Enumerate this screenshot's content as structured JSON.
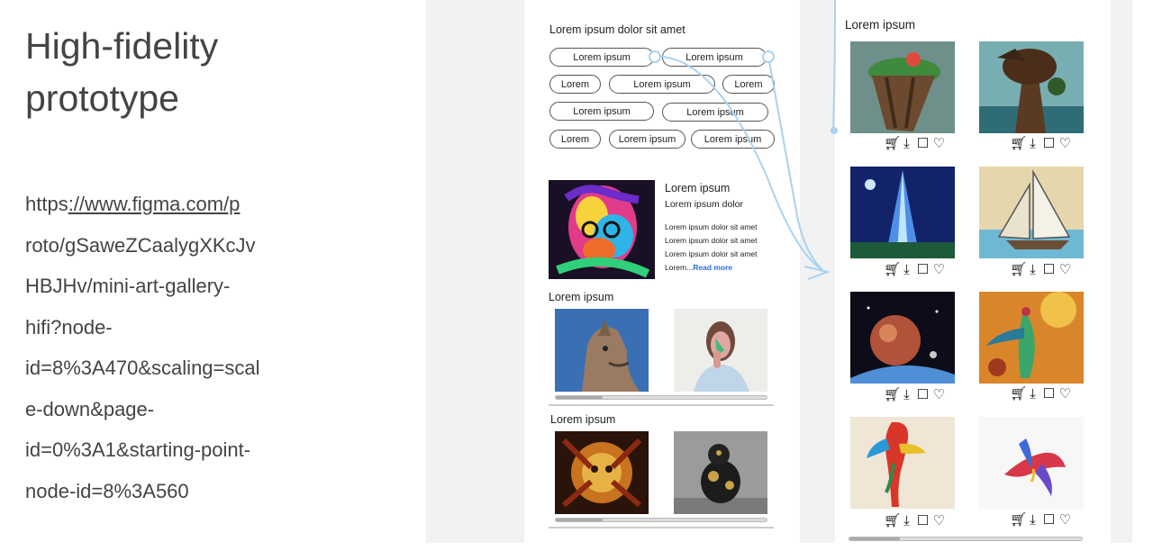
{
  "slide": {
    "title_line1": "High-fidelity",
    "title_line2": "prototype",
    "url_lines": [
      {
        "a": "https",
        "u": "://www.figma.com/p",
        "b": ""
      },
      {
        "a": "roto/gSaweZCaalygXKcJv",
        "u": "",
        "b": ""
      },
      {
        "a": "HBJHv/mini-art-gallery-",
        "u": "",
        "b": ""
      },
      {
        "a": "hifi?node-",
        "u": "",
        "b": ""
      },
      {
        "a": "id=8%3A470&scaling=scal",
        "u": "",
        "b": ""
      },
      {
        "a": "e-down&page-",
        "u": "",
        "b": ""
      },
      {
        "a": "id=0%3A1&starting-point-",
        "u": "",
        "b": ""
      },
      {
        "a": "node-id=8%3A560",
        "u": "",
        "b": ""
      }
    ]
  },
  "screen1": {
    "heading": "Lorem ipsum dolor sit amet",
    "tags": [
      "Lorem ipsum",
      "Lorem ipsum",
      "Lorem",
      "Lorem ipsum",
      "Lorem",
      "Lorem ipsum",
      "Lorem ipsum",
      "Lorem",
      "Lorem ipsum",
      "Lorem ipsum"
    ],
    "featured": {
      "title": "Lorem ipsum",
      "subtitle": "Lorem ipsum dolor",
      "body": [
        "Lorem ipsum dolor sit amet",
        "Lorem ipsum dolor sit amet",
        "Lorem ipsum dolor sit amet"
      ],
      "last_prefix": "Lorem...",
      "read_more": "Read more"
    },
    "section1_title": "Lorem ipsum",
    "section2_title": "Lorem ipsum"
  },
  "screen2": {
    "heading": "Lorem ipsum",
    "actions": {
      "cart": "cart-icon",
      "download": "download-icon",
      "comment": "comment-icon",
      "like": "heart-icon"
    },
    "action_glyphs": [
      "🛒︎",
      "⤓",
      "☐",
      "♡"
    ]
  },
  "colors": {
    "canvas": "#f2f2f2",
    "flow_arrow": "#a9d2f0",
    "link": "#2a6fd6"
  }
}
